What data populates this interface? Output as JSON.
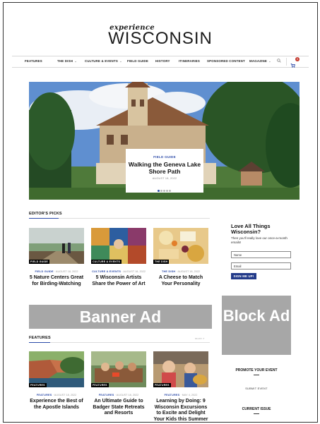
{
  "header": {
    "logo_small": "experience",
    "logo_big": "WISCONSIN"
  },
  "nav": {
    "items": [
      {
        "label": "FEATURES",
        "caret": ""
      },
      {
        "label": "THE DISH",
        "caret": "⌄"
      },
      {
        "label": "CULTURE & EVENTS",
        "caret": "⌄"
      },
      {
        "label": "FIELD GUIDE",
        "caret": ""
      },
      {
        "label": "HISTORY",
        "caret": ""
      },
      {
        "label": "ITINERARIES",
        "caret": ""
      },
      {
        "label": "SPONSORED CONTENT",
        "caret": ""
      },
      {
        "label": "MAGAZINE",
        "caret": "⌄"
      }
    ],
    "search_icon": "search-icon",
    "cart_icon": "cart-icon",
    "cart_count": "0"
  },
  "hero": {
    "category": "FIELD GUIDE",
    "title": "Walking the Geneva Lake Shore Path",
    "date": "AUGUST 18, 2022",
    "slide_count": 5,
    "active_slide": 1
  },
  "editors_picks": {
    "heading": "EDITOR'S PICKS",
    "cards": [
      {
        "tag": "FIELD GUIDE",
        "category": "FIELD GUIDE",
        "date": "· AUGUST 18, 2022",
        "title": "5 Nature Centers Great for Birding-Watching"
      },
      {
        "tag": "CULTURE & EVENTS",
        "category": "CULTURE & EVENTS",
        "date": "· AUGUST 18, 2022",
        "title": "5 Wisconsin Artists Share the Power of Art"
      },
      {
        "tag": "THE DISH",
        "category": "THE DISH",
        "date": "· AUGUST 18, 2022",
        "title": "A Cheese to Match Your Personality"
      }
    ]
  },
  "ads": {
    "banner": "Banner Ad",
    "block": "Block Ad"
  },
  "features": {
    "heading": "FEATURES",
    "more": "more »",
    "cards": [
      {
        "tag": "FEATURES",
        "category": "FEATURES",
        "date": "· AUGUST 18, 2022",
        "title": "Experience the Best of the Apostle Islands"
      },
      {
        "tag": "FEATURES",
        "category": "FEATURES",
        "date": "· AUGUST 18, 2022",
        "title": "An Ultimate Guide to Badger State Retreats and Resorts"
      },
      {
        "tag": "FEATURES",
        "category": "FEATURES",
        "date": "· MAY 4, 2022",
        "title": "Learning by Doing: 9 Wisconsin Excursions to Excite and Delight Your Kids this Summer"
      }
    ]
  },
  "newsletter": {
    "title": "Love All Things Wisconsin?",
    "subtitle": "Then you'll really love our once-a-month emails!",
    "name_placeholder": "Name",
    "email_placeholder": "Email",
    "button": "SIGN ME UP!"
  },
  "sidebar": {
    "promote_heading": "PROMOTE YOUR EVENT",
    "submit_link": "SUBMIT EVENT",
    "issue_heading": "CURRENT ISSUE"
  }
}
